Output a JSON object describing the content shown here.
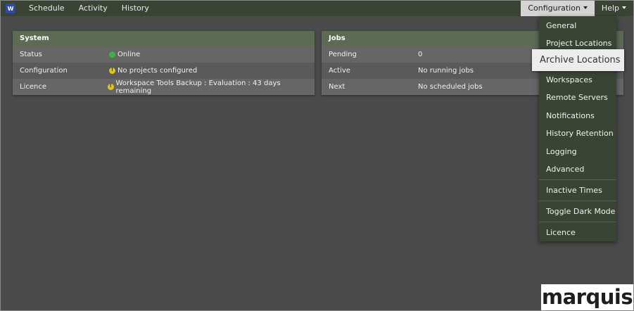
{
  "nav": {
    "logo_letter": "W",
    "links": [
      "Schedule",
      "Activity",
      "History"
    ],
    "configuration_label": "Configuration",
    "help_label": "Help"
  },
  "system_panel": {
    "title": "System",
    "rows": [
      {
        "label": "Status",
        "value": "Online",
        "indicator": "green"
      },
      {
        "label": "Configuration",
        "value": "No projects configured",
        "indicator": "warning"
      },
      {
        "label": "Licence",
        "value": "Workspace Tools Backup : Evaluation : 43 days remaining",
        "indicator": "warning"
      }
    ]
  },
  "jobs_panel": {
    "title": "Jobs",
    "rows": [
      {
        "label": "Pending",
        "value": "0"
      },
      {
        "label": "Active",
        "value": "No running jobs"
      },
      {
        "label": "Next",
        "value": "No scheduled jobs"
      }
    ]
  },
  "config_menu": {
    "items": [
      "General",
      "Project Locations",
      "Archive Locations",
      "Workspaces",
      "Remote Servers",
      "Notifications",
      "History Retention",
      "Logging",
      "Advanced",
      "Inactive Times",
      "Toggle Dark Mode",
      "Licence"
    ],
    "highlighted": "Archive Locations"
  },
  "brand": "marquis",
  "colors": {
    "background": "#4a4a4a",
    "navbar": "#3a4434",
    "panel_header": "#5d6b55",
    "status_ok": "#3cb43c",
    "status_warning": "#e1c21a"
  }
}
